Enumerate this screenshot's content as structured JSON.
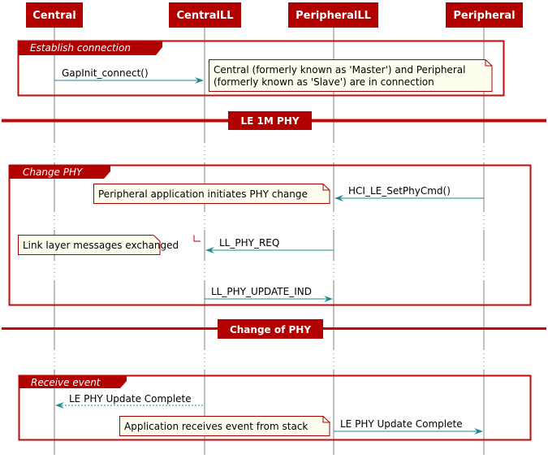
{
  "colors": {
    "participant_fill": "#B00000",
    "frame_border": "#C20A0A",
    "arrow": "#1A8A8F",
    "note_fill": "#FEFEEE",
    "note_border": "#A80000",
    "lifeline": "#808080"
  },
  "participants": [
    {
      "id": "central",
      "label": "Central"
    },
    {
      "id": "centralll",
      "label": "CentralLL"
    },
    {
      "id": "peripheralll",
      "label": "PeripheralLL"
    },
    {
      "id": "peripheral",
      "label": "Peripheral"
    }
  ],
  "groups": [
    {
      "title": "Establish connection"
    },
    {
      "title": "Change PHY"
    },
    {
      "title": "Receive event"
    }
  ],
  "dividers": [
    {
      "label": "LE 1M PHY"
    },
    {
      "label": "Change of PHY"
    }
  ],
  "messages": [
    {
      "label": "GapInit_connect()",
      "from": "central",
      "to": "centralll",
      "style": "solid"
    },
    {
      "label": "HCI_LE_SetPhyCmd()",
      "from": "peripheral",
      "to": "peripheralll",
      "style": "solid"
    },
    {
      "label": "LL_PHY_REQ",
      "from": "peripheralll",
      "to": "centralll",
      "style": "solid"
    },
    {
      "label": "LL_PHY_UPDATE_IND",
      "from": "centralll",
      "to": "peripheralll",
      "style": "solid"
    },
    {
      "label": "LE PHY Update Complete",
      "from": "centralll",
      "to": "central",
      "style": "dotted"
    },
    {
      "label": "LE PHY Update Complete",
      "from": "peripheralll",
      "to": "peripheral",
      "style": "solid"
    }
  ],
  "notes": [
    {
      "lines": [
        "Central (formerly known as 'Master') and Peripheral",
        "(formerly known as 'Slave')  are in connection"
      ]
    },
    {
      "lines": [
        "Peripheral application initiates PHY change"
      ]
    },
    {
      "lines": [
        "Link layer messages exchanged"
      ]
    },
    {
      "lines": [
        "Application receives event from stack"
      ]
    }
  ]
}
